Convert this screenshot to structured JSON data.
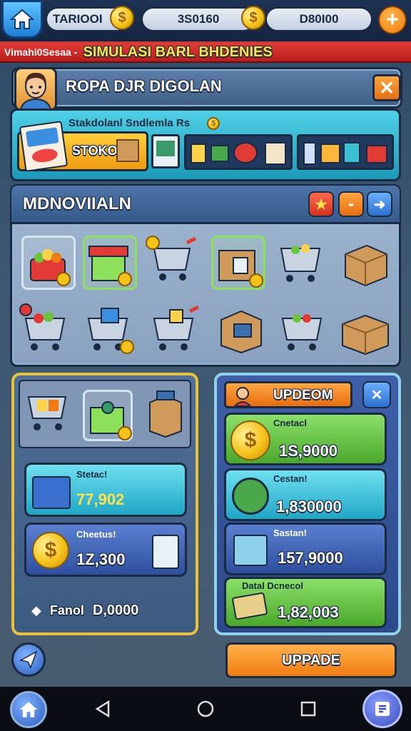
{
  "topbar": {
    "player_name": "TARIOOI",
    "currency_a": "3S0160",
    "currency_b": "D80I00",
    "coin_glyph": "$",
    "plus_glyph": "+"
  },
  "banner": {
    "subtitle": "Vimahi0Sesaa -",
    "title": "SIMULASI BARL BHDENIES"
  },
  "header": {
    "title": "ROPA DJR DIGOLAN",
    "close_glyph": "✕"
  },
  "store": {
    "label": "Stakdolanl Sndlemla Rs",
    "tag": "STOKO"
  },
  "catalog": {
    "title": "MDNOVIIALN",
    "star_glyph": "★",
    "next_glyph": "➜"
  },
  "left_panel": {
    "stat1_label": "Stetac!",
    "stat1_value": "77,902",
    "stat2_label": "Cheetus!",
    "stat2_value": "1Z,300",
    "footer_label": "Fanol",
    "footer_value": "D,0000"
  },
  "upgrade_panel": {
    "title": "UPDEOM",
    "rows": [
      {
        "label": "Cnetacl",
        "value": "1S,9000"
      },
      {
        "label": "Cestan!",
        "value": "1,830000"
      },
      {
        "label": "Sastan!",
        "value": "157,9000"
      },
      {
        "label": "Datal Dcnecol",
        "value": "1,82,003"
      }
    ]
  },
  "actions": {
    "upgrade_button": "UPPADE"
  },
  "colors": {
    "accent_orange": "#f07c10",
    "banner_red": "#d42a26",
    "banner_yellow": "#ffe24a",
    "panel_blue": "#4f6f96",
    "teal": "#2bb5d0",
    "green": "#6cc43a"
  }
}
